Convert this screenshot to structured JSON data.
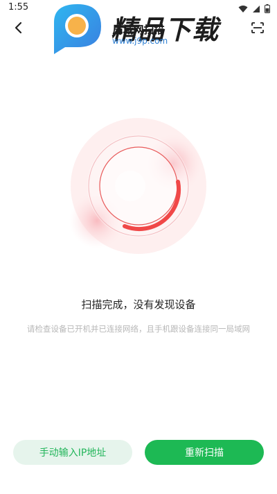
{
  "status_bar": {
    "time": "1:55",
    "icons": [
      "wifi-icon",
      "signal-icon",
      "battery-icon"
    ]
  },
  "appbar": {
    "title": "局域网扫描",
    "back_icon": "chevron-left-icon",
    "scan_icon": "scan-frame-icon"
  },
  "watermark": {
    "brand": "精品下载",
    "url": "www.j9p.com"
  },
  "result": {
    "title": "扫描完成，没有发现设备",
    "hint": "请检查设备已开机并已连接网络，且手机跟设备连接同一局域网"
  },
  "buttons": {
    "manual_label": "手动输入IP地址",
    "rescan_label": "重新扫描"
  },
  "colors": {
    "accent_green": "#1db954",
    "light_green_bg": "#e6f4ec",
    "radar_red": "#f04848"
  }
}
